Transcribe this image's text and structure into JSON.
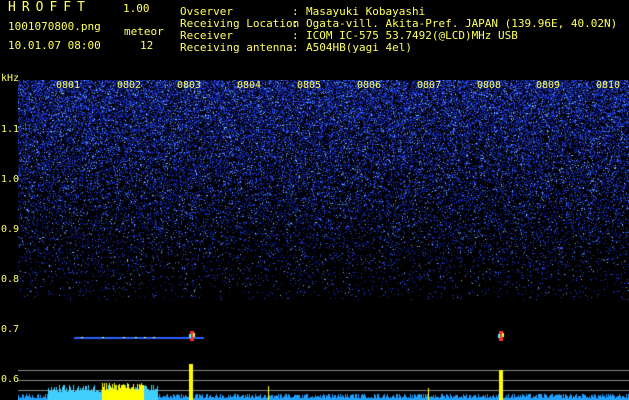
{
  "app": {
    "title": "HROFFT",
    "version": "1.00"
  },
  "file": {
    "name": "1001070800.png",
    "datetime": "10.01.07 08:00"
  },
  "meteor": {
    "label": "meteor",
    "count": "12"
  },
  "info": [
    {
      "key": "Ovserver",
      "value": "Masayuki Kobayashi"
    },
    {
      "key": "Receiving Location",
      "value": "Ogata-vill. Akita-Pref. JAPAN (139.96E, 40.02N)"
    },
    {
      "key": "Receiver",
      "value": "ICOM IC-575 53.7492(@LCD)MHz USB"
    },
    {
      "key": "Receiving antenna",
      "value": "A504HB(yagi 4el)"
    }
  ],
  "axis": {
    "unit": "kHz",
    "freq_ticks": [
      "1.1",
      "1.0",
      "0.9",
      "0.8",
      "0.7",
      "0.6"
    ],
    "time_ticks": [
      "0801",
      "0802",
      "0803",
      "0804",
      "0805",
      "0806",
      "0807",
      "0808",
      "0809",
      "0810"
    ]
  },
  "colors": {
    "label": "#ffff60",
    "background": "#000000",
    "noise": "#2a3cc8",
    "signal": "#ff3030",
    "histogram": "#ffff00"
  }
}
